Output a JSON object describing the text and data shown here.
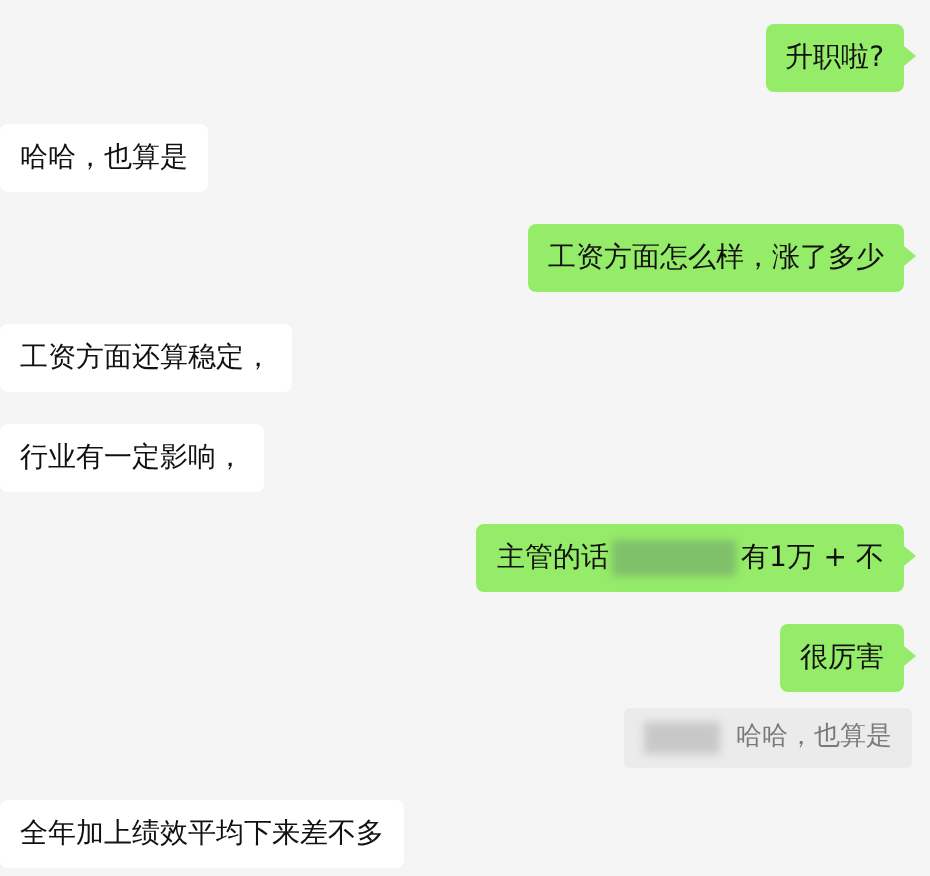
{
  "messages": [
    {
      "outgoing": true,
      "kind": "text",
      "text": "升职啦?"
    },
    {
      "outgoing": false,
      "kind": "text",
      "text": "哈哈，也算是"
    },
    {
      "outgoing": true,
      "kind": "text",
      "text": "工资方面怎么样，涨了多少"
    },
    {
      "outgoing": false,
      "kind": "text",
      "text": "工资方面还算稳定，"
    },
    {
      "outgoing": false,
      "kind": "text",
      "text": "行业有一定影响，"
    },
    {
      "outgoing": true,
      "kind": "redacted",
      "text_before": "主管的话",
      "text_after": "有1万 + 不"
    },
    {
      "outgoing": true,
      "kind": "text",
      "text": "很厉害"
    },
    {
      "outgoing": true,
      "kind": "quote",
      "text": "哈哈，也算是"
    },
    {
      "outgoing": false,
      "kind": "text",
      "text": "全年加上绩效平均下来差不多"
    }
  ]
}
